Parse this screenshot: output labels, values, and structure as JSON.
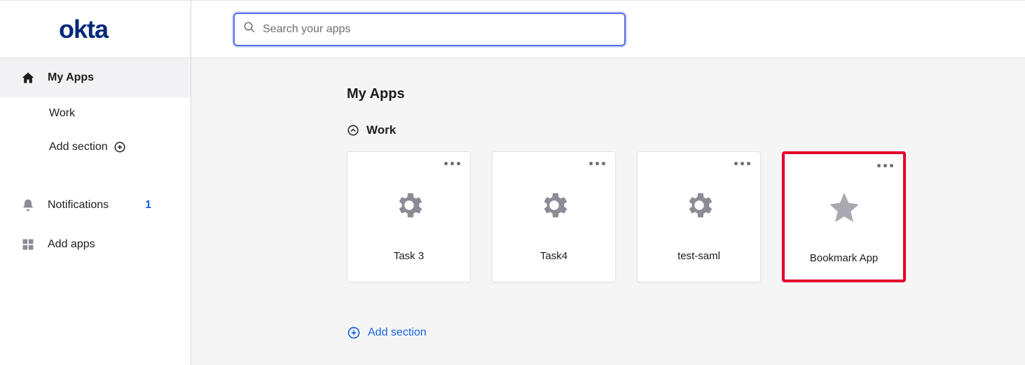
{
  "logo": "okta",
  "search": {
    "placeholder": "Search your apps"
  },
  "sidebar": {
    "my_apps": "My Apps",
    "work": "Work",
    "add_section": "Add section",
    "notifications": "Notifications",
    "notifications_count": "1",
    "add_apps": "Add apps"
  },
  "page": {
    "title": "My Apps",
    "section": "Work",
    "add_section": "Add section"
  },
  "apps": [
    {
      "label": "Task 3",
      "icon": "gear",
      "highlight": false
    },
    {
      "label": "Task4",
      "icon": "gear",
      "highlight": false
    },
    {
      "label": "test-saml",
      "icon": "gear",
      "highlight": false
    },
    {
      "label": "Bookmark App",
      "icon": "star",
      "highlight": true
    }
  ]
}
